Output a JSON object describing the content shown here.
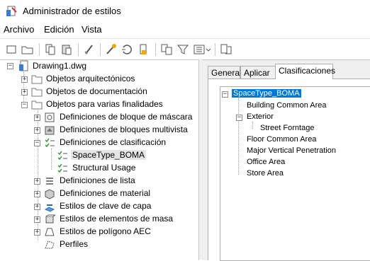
{
  "window": {
    "title": "Administrador de estilos"
  },
  "menu": [
    {
      "label": "Archivo"
    },
    {
      "label": "Edición"
    },
    {
      "label": "Vista"
    }
  ],
  "toolbar": {
    "buttons": [
      "new-icon",
      "open-icon",
      "copy-icon",
      "paste-icon",
      "purge-icon",
      "edit-style-icon",
      "sort-icon",
      "set-current-icon",
      "set-from-icon",
      "filter-icon",
      "view-options-icon",
      "toggle-view-icon"
    ]
  },
  "tree": {
    "root": "Drawing1.dwg",
    "items": [
      {
        "label": "Objetos arquitectónicos"
      },
      {
        "label": "Objetos de documentación"
      },
      {
        "label": "Objetos para varias finalidades"
      },
      {
        "label": "Definiciones de bloque de máscara"
      },
      {
        "label": "Definiciones de bloques multivista"
      },
      {
        "label": "Definiciones de clasificación"
      },
      {
        "label": "SpaceType_BOMA"
      },
      {
        "label": "Structural Usage"
      },
      {
        "label": "Definiciones de lista"
      },
      {
        "label": "Definiciones de material"
      },
      {
        "label": "Estilos de clave de capa"
      },
      {
        "label": "Estilos de elementos de masa"
      },
      {
        "label": "Estilos de polígono AEC"
      },
      {
        "label": "Perfiles"
      }
    ]
  },
  "tabs": [
    {
      "label": "General"
    },
    {
      "label": "Aplicar a"
    },
    {
      "label": "Clasificaciones"
    }
  ],
  "classifications": {
    "root": "SpaceType_BOMA",
    "items": [
      {
        "label": "Building Common Area"
      },
      {
        "label": "Exterior"
      },
      {
        "label": "Street Forntage"
      },
      {
        "label": "Floor Common Area"
      },
      {
        "label": "Major Vertical Penetration"
      },
      {
        "label": "Office Area"
      },
      {
        "label": "Store Area"
      }
    ]
  },
  "colors": {
    "selection": "#0078d7",
    "panel": "#f0f0f0"
  }
}
